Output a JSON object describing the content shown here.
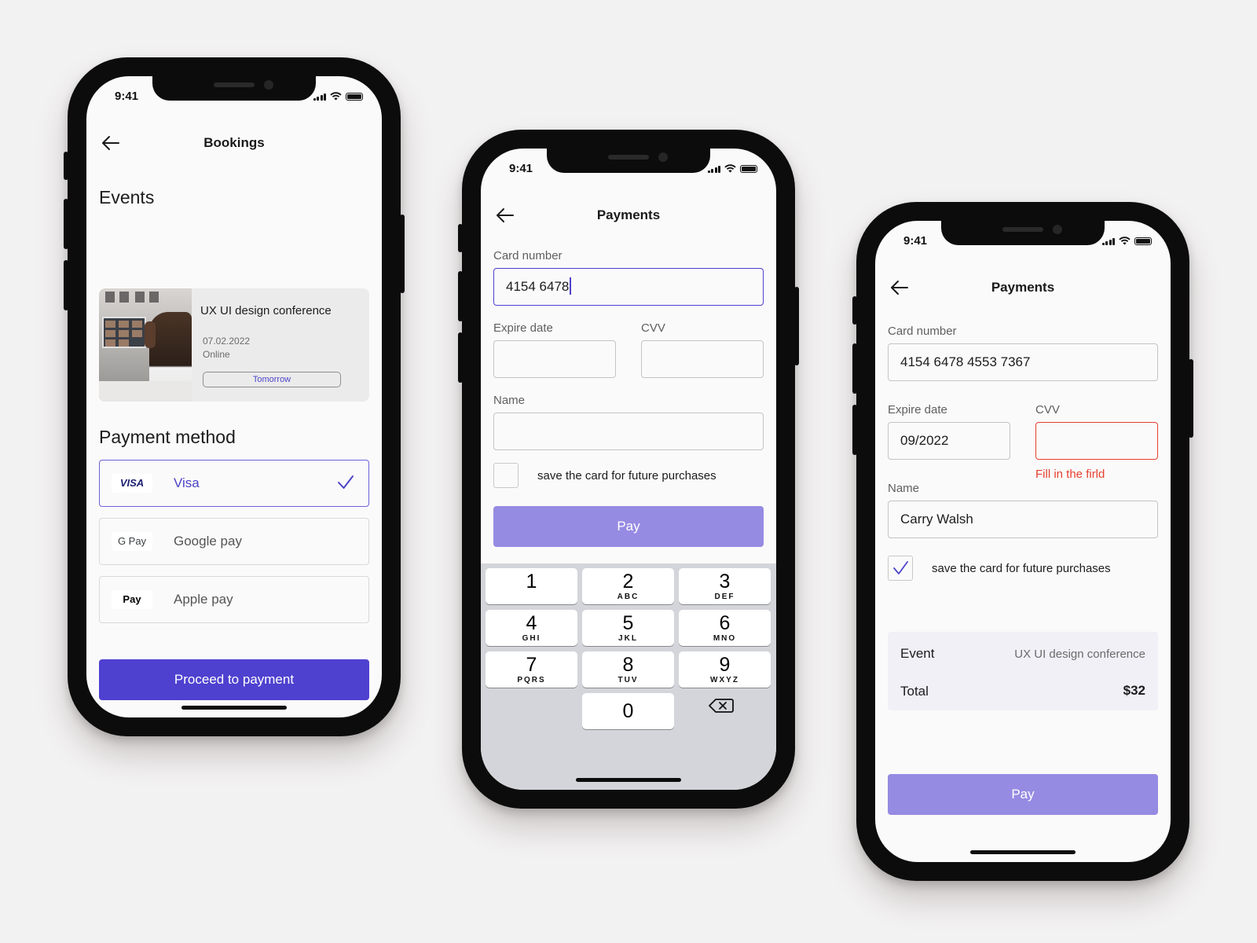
{
  "status_time": "9:41",
  "colors": {
    "accent": "#4e41cf",
    "accent_disabled": "#958be2",
    "error": "#e5412f",
    "background": "#f3f2f2"
  },
  "screen1": {
    "title": "Bookings",
    "events_heading": "Events",
    "event": {
      "title": "UX UI design conference",
      "date": "07.02.2022",
      "location": "Online",
      "badge": "Tomorrow"
    },
    "payment_heading": "Payment method",
    "methods": [
      {
        "logo": "VISA",
        "label": "Visa",
        "selected": true
      },
      {
        "logo": "G Pay",
        "label": "Google pay",
        "selected": false
      },
      {
        "logo": " Pay",
        "label": "Apple pay",
        "selected": false
      }
    ],
    "proceed_label": "Proceed to payment"
  },
  "screen2": {
    "title": "Payments",
    "card_label": "Card number",
    "card_value": "4154 6478",
    "expire_label": "Expire date",
    "expire_value": "",
    "cvv_label": "CVV",
    "cvv_value": "",
    "name_label": "Name",
    "name_value": "",
    "save_label": "save the card for future purchases",
    "save_checked": false,
    "pay_label": "Pay",
    "keypad": {
      "keys": [
        {
          "digit": "1",
          "letters": ""
        },
        {
          "digit": "2",
          "letters": "ABC"
        },
        {
          "digit": "3",
          "letters": "DEF"
        },
        {
          "digit": "4",
          "letters": "GHI"
        },
        {
          "digit": "5",
          "letters": "JKL"
        },
        {
          "digit": "6",
          "letters": "MNO"
        },
        {
          "digit": "7",
          "letters": "PQRS"
        },
        {
          "digit": "8",
          "letters": "TUV"
        },
        {
          "digit": "9",
          "letters": "WXYZ"
        },
        {
          "digit": "0",
          "letters": ""
        }
      ]
    }
  },
  "screen3": {
    "title": "Payments",
    "card_label": "Card number",
    "card_value": "4154 6478 4553 7367",
    "expire_label": "Expire date",
    "expire_value": "09/2022",
    "cvv_label": "CVV",
    "cvv_value": "",
    "cvv_error": "Fill in the firld",
    "name_label": "Name",
    "name_value": "Carry Walsh",
    "save_label": "save the card for future purchases",
    "save_checked": true,
    "summary": {
      "event_label": "Event",
      "event_value": "UX UI design conference",
      "total_label": "Total",
      "total_value": "$32"
    },
    "pay_label": "Pay"
  }
}
